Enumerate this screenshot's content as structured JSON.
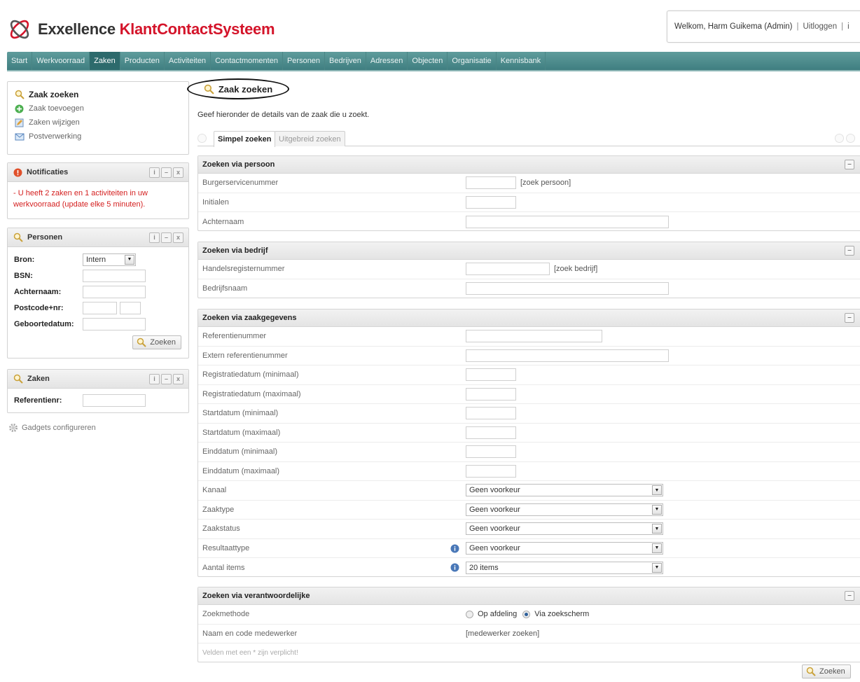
{
  "app": {
    "logo_brand": "Exxellence",
    "logo_accent": "KlantContactSysteem",
    "colors": {
      "brand": "#333333",
      "accent": "#d4142a",
      "nav": "#4a8a8a",
      "error": "#d42020"
    }
  },
  "header": {
    "welcome": "Welkom, Harm Guikema (Admin)",
    "sep1": "|",
    "logout": "Uitloggen",
    "sep2": "|",
    "extra": "i"
  },
  "nav": {
    "items": [
      {
        "label": "Start"
      },
      {
        "label": "Werkvoorraad"
      },
      {
        "label": "Zaken",
        "active": true
      },
      {
        "label": "Producten"
      },
      {
        "label": "Activiteiten"
      },
      {
        "label": "Contactmomenten"
      },
      {
        "label": "Personen"
      },
      {
        "label": "Bedrijven"
      },
      {
        "label": "Adressen"
      },
      {
        "label": "Objecten"
      },
      {
        "label": "Organisatie"
      },
      {
        "label": "Kennisbank"
      }
    ]
  },
  "sidebar": {
    "actions": [
      {
        "label": "Zaak zoeken",
        "icon": "search-icon"
      },
      {
        "label": "Zaak toevoegen",
        "icon": "add-icon"
      },
      {
        "label": "Zaken wijzigen",
        "icon": "edit-icon"
      },
      {
        "label": "Postverwerking",
        "icon": "mail-icon"
      }
    ],
    "notifications": {
      "title": "Notificaties",
      "message": "- U heeft 2 zaken en 1 activiteiten in uw werkvoorraad (update elke 5 minuten)."
    },
    "personen": {
      "title": "Personen",
      "bron_label": "Bron:",
      "bron_value": "Intern",
      "bsn_label": "BSN:",
      "achternaam_label": "Achternaam:",
      "postcode_label": "Postcode+nr:",
      "geboortedatum_label": "Geboortedatum:",
      "button": "Zoeken"
    },
    "zaken": {
      "title": "Zaken",
      "ref_label": "Referentienr:"
    },
    "gadgets": "Gadgets configureren"
  },
  "main": {
    "title": "Zaak zoeken",
    "intro": "Geef hieronder de details van de zaak die u zoekt.",
    "tabs": [
      {
        "label": "Simpel zoeken",
        "active": true
      },
      {
        "label": "Uitgebreid zoeken",
        "active": false
      }
    ],
    "persoon": {
      "title": "Zoeken via persoon",
      "bsn": "Burgerservicenummer",
      "zoek_persoon": "[zoek persoon]",
      "initialen": "Initialen",
      "achternaam": "Achternaam"
    },
    "bedrijf": {
      "title": "Zoeken via bedrijf",
      "kvk": "Handelsregisternummer",
      "zoek_bedrijf": "[zoek bedrijf]",
      "naam": "Bedrijfsnaam"
    },
    "zaakgegevens": {
      "title": "Zoeken via zaakgegevens",
      "referentie": "Referentienummer",
      "extern": "Extern referentienummer",
      "reg_min": "Registratiedatum (minimaal)",
      "reg_max": "Registratiedatum (maximaal)",
      "start_min": "Startdatum (minimaal)",
      "start_max": "Startdatum (maximaal)",
      "eind_min": "Einddatum (minimaal)",
      "eind_max": "Einddatum (maximaal)",
      "kanaal": "Kanaal",
      "kanaal_value": "Geen voorkeur",
      "zaaktype": "Zaaktype",
      "zaaktype_value": "Geen voorkeur",
      "zaakstatus": "Zaakstatus",
      "zaakstatus_value": "Geen voorkeur",
      "resultaattype": "Resultaattype",
      "resultaattype_value": "Geen voorkeur",
      "aantal": "Aantal items",
      "aantal_value": "20 items"
    },
    "verantwoordelijke": {
      "title": "Zoeken via verantwoordelijke",
      "methode": "Zoekmethode",
      "optie1": "Op afdeling",
      "optie2": "Via zoekscherm",
      "medewerker": "Naam en code medewerker",
      "medewerker_link": "[medewerker zoeken]",
      "note": "Velden met een * zijn verplicht!"
    },
    "submit": "Zoeken"
  }
}
